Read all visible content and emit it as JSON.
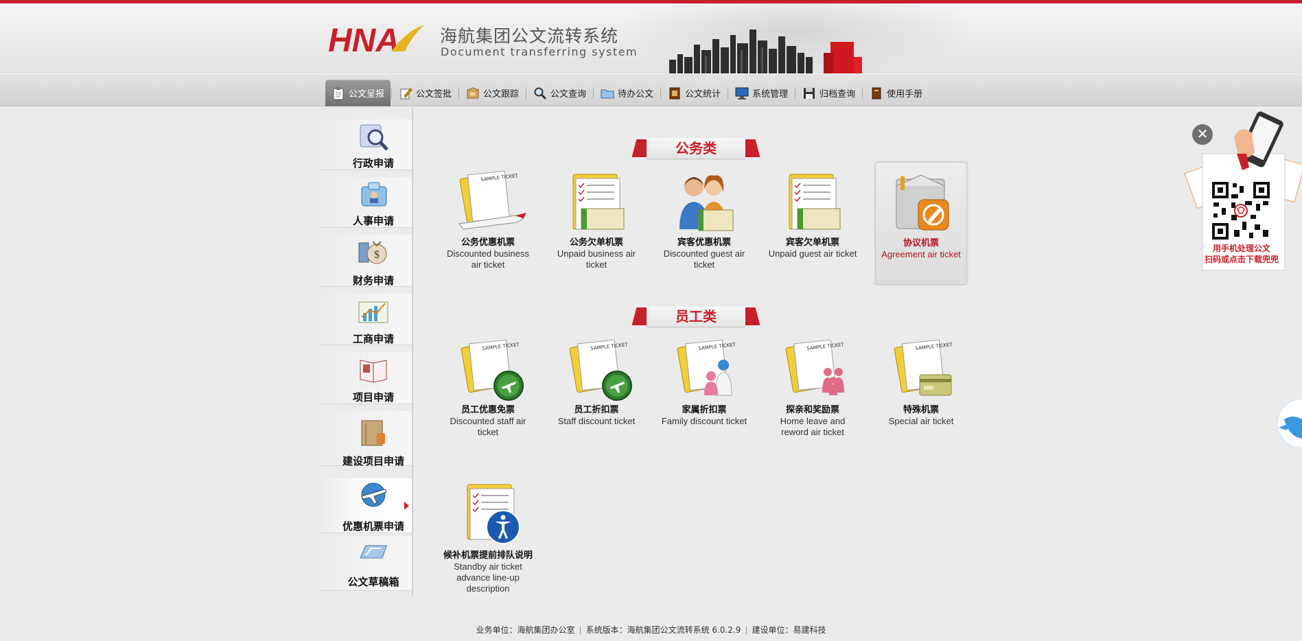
{
  "header": {
    "logo_text": "HNA",
    "title": "海航集团公文流转系统",
    "subtitle": "Document  transferring system"
  },
  "nav": {
    "items": [
      {
        "label": "公文呈报",
        "icon": "clipboard-icon",
        "active": true
      },
      {
        "label": "公文签批",
        "icon": "pen-paper-icon"
      },
      {
        "label": "公文跟踪",
        "icon": "box-icon"
      },
      {
        "label": "公文查询",
        "icon": "magnifier-icon"
      },
      {
        "label": "待办公文",
        "icon": "folder-icon"
      },
      {
        "label": "公文统计",
        "icon": "stats-book-icon"
      },
      {
        "label": "系统管理",
        "icon": "monitor-icon"
      },
      {
        "label": "归档查询",
        "icon": "floppy-disk-icon"
      },
      {
        "label": "使用手册",
        "icon": "manual-book-icon"
      }
    ]
  },
  "sidebar": {
    "items": [
      {
        "label": "行政申请",
        "icon": "admin-search-icon"
      },
      {
        "label": "人事申请",
        "icon": "personnel-icon"
      },
      {
        "label": "财务申请",
        "icon": "money-bag-icon"
      },
      {
        "label": "工商申请",
        "icon": "business-chart-icon"
      },
      {
        "label": "项目申请",
        "icon": "project-book-icon"
      },
      {
        "label": "建设项目申请",
        "icon": "construction-icon"
      },
      {
        "label": "优惠机票申请",
        "icon": "airplane-icon",
        "active": true
      },
      {
        "label": "公文草稿箱",
        "icon": "draft-box-icon"
      }
    ]
  },
  "sections": {
    "official": {
      "title": "公务类",
      "tiles": [
        {
          "cn": "公务优惠机票",
          "en": "Discounted business air ticket"
        },
        {
          "cn": "公务欠单机票",
          "en": "Unpaid business air ticket"
        },
        {
          "cn": "宾客优惠机票",
          "en": "Discounted guest air ticket"
        },
        {
          "cn": "宾客欠单机票",
          "en": "Unpaid guest air ticket"
        },
        {
          "cn": "协议机票",
          "en": "Agreement air ticket"
        }
      ]
    },
    "staff": {
      "title": "员工类",
      "tiles": [
        {
          "cn": "员工优惠免票",
          "en": "Discounted staff air ticket"
        },
        {
          "cn": "员工折扣票",
          "en": "Staff discount ticket"
        },
        {
          "cn": "家属折扣票",
          "en": "Family discount ticket"
        },
        {
          "cn": "探亲和奖励票",
          "en": "Home leave and reword air ticket"
        },
        {
          "cn": "特殊机票",
          "en": "Special air ticket"
        },
        {
          "cn": "候补机票提前排队说明",
          "en": "Standby air ticket advance line-up description"
        }
      ]
    }
  },
  "ticket_label": "SAMPLE TICKET",
  "qr": {
    "line1": "用手机处理公文",
    "line2": "扫码或点击下载兜兜"
  },
  "footer": {
    "unit": "业务单位：海航集团办公室",
    "version": "系统版本：海航集团公文流转系统 6.0.2.9",
    "builder": "建设单位：易建科技"
  },
  "colors": {
    "brand_red": "#c8202a",
    "background": "#ebebeb"
  }
}
